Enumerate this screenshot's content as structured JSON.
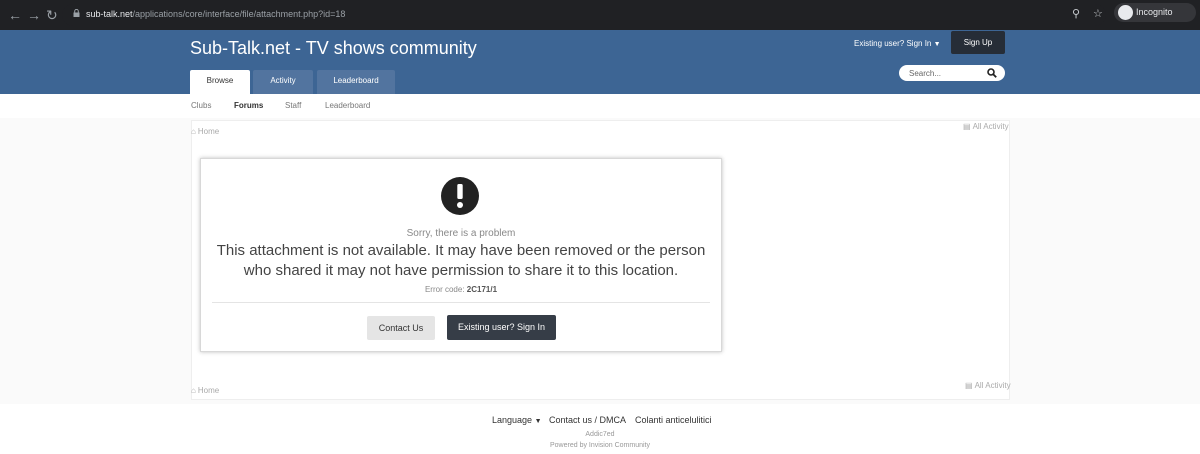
{
  "browser": {
    "url_host": "sub-talk.net",
    "url_path": "/applications/core/interface/file/attachment.php?id=18",
    "profile_label": "Incognito"
  },
  "header": {
    "site_title": "Sub-Talk.net - TV shows community",
    "signin_label": "Existing user? Sign In",
    "signup_label": "Sign Up",
    "search_placeholder": "Search...",
    "tabs": [
      "Browse",
      "Activity",
      "Leaderboard"
    ]
  },
  "subnav": {
    "items": [
      "Clubs",
      "Forums",
      "Staff",
      "Leaderboard"
    ],
    "active": "Forums"
  },
  "breadcrumb": {
    "home": "Home",
    "all_activity": "All Activity"
  },
  "error": {
    "title": "Sorry, there is a problem",
    "message": "This attachment is not available. It may have been removed or the person who shared it may not have permission to share it to this location.",
    "code_label": "Error code:",
    "code": "2C171/1",
    "contact_label": "Contact Us",
    "signin_label": "Existing user? Sign In"
  },
  "footer": {
    "language_label": "Language",
    "contact_label": "Contact us / DMCA",
    "partner_label": "Colanti anticelulitici",
    "copyright": "Addic7ed",
    "powered_by": "Powered by Invision Community"
  },
  "colors": {
    "header_bg": "#3d6594",
    "tab_bg": "#52749f",
    "dark_button": "#363d47",
    "chrome_bg": "#202124"
  }
}
